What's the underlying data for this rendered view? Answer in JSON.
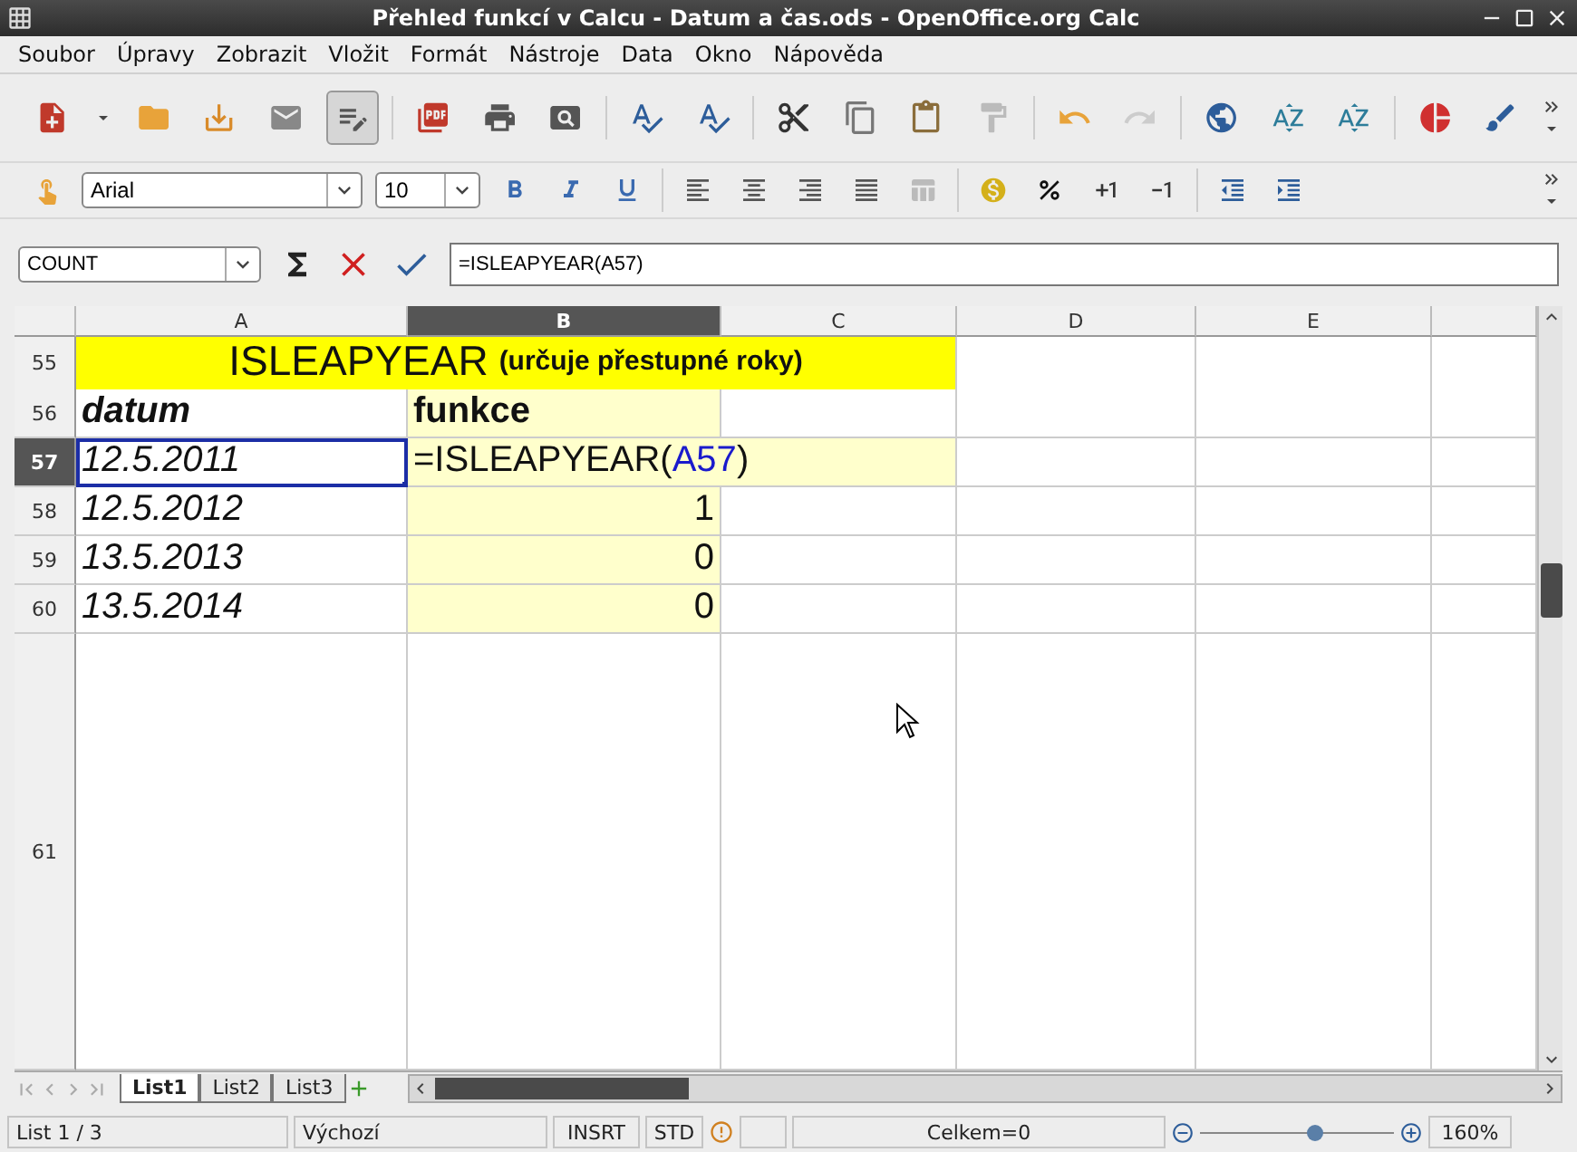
{
  "window": {
    "title": "Přehled funkcí v Calcu - Datum a čas.ods - OpenOffice.org Calc"
  },
  "menu": [
    "Soubor",
    "Úpravy",
    "Zobrazit",
    "Vložit",
    "Formát",
    "Nástroje",
    "Data",
    "Okno",
    "Nápověda"
  ],
  "formatting": {
    "font": "Arial",
    "size": "10"
  },
  "formula_bar": {
    "name_box": "COUNT",
    "formula": "=ISLEAPYEAR(A57)"
  },
  "columns": [
    {
      "label": "A",
      "selected": false
    },
    {
      "label": "B",
      "selected": true
    },
    {
      "label": "C",
      "selected": false
    },
    {
      "label": "D",
      "selected": false
    },
    {
      "label": "E",
      "selected": false
    }
  ],
  "rows": [
    {
      "number": "55",
      "selected": false,
      "kind": "title",
      "title": "ISLEAPYEAR",
      "subtitle": "(určuje přestupné roky)"
    },
    {
      "number": "56",
      "selected": false,
      "kind": "header",
      "a": "datum",
      "b": "funkce"
    },
    {
      "number": "57",
      "selected": true,
      "kind": "formula",
      "a": "12.5.2011",
      "formula": "=ISLEAPYEAR(",
      "ref": "A57",
      "close": ")"
    },
    {
      "number": "58",
      "selected": false,
      "kind": "value",
      "a": "12.5.2012",
      "b": "1"
    },
    {
      "number": "59",
      "selected": false,
      "kind": "value",
      "a": "13.5.2013",
      "b": "0"
    },
    {
      "number": "60",
      "selected": false,
      "kind": "value",
      "a": "13.5.2014",
      "b": "0"
    },
    {
      "number": "61",
      "selected": false,
      "kind": "empty"
    }
  ],
  "sheet_tabs": [
    {
      "label": "List1",
      "selected": true
    },
    {
      "label": "List2",
      "selected": false
    },
    {
      "label": "List3",
      "selected": false
    }
  ],
  "status_bar": {
    "sheet": "List 1 / 3",
    "style": "Výchozí",
    "insert_mode": "INSRT",
    "selection_mode": "STD",
    "sum": "Celkem=0",
    "zoom": "160%",
    "zoom_slider": {
      "level": 0.59
    }
  }
}
